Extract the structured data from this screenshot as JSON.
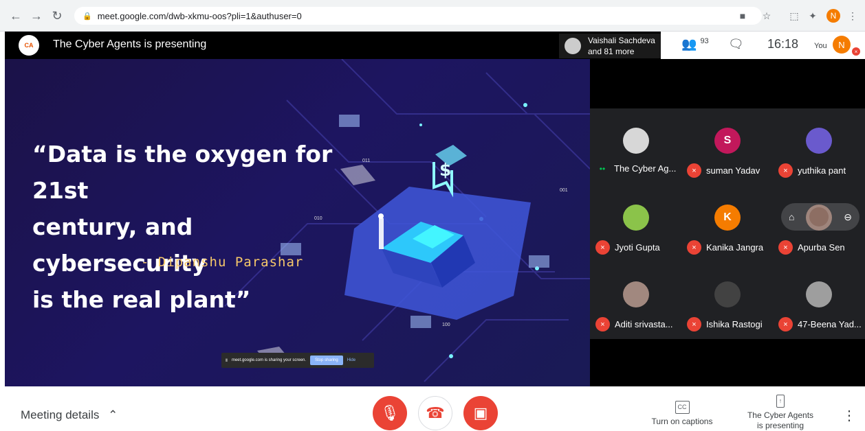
{
  "browser": {
    "url": "meet.google.com/dwb-xkmu-oos?pli=1&authuser=0",
    "profile_initial": "N"
  },
  "meeting": {
    "presenting_text": "The Cyber Agents is presenting",
    "attendees_chip": {
      "name": "Vaishali Sachdeva",
      "more": "and 81 more"
    },
    "participant_count": "93",
    "time": "16:18",
    "you_label": "You",
    "you_initial": "N"
  },
  "slide": {
    "quote_lines": [
      "“Data is the oxygen for 21st",
      "century, and cybersecurity",
      "is the real plant”"
    ],
    "author": "- Dipanshu Parashar",
    "share_notice": "meet.google.com is sharing your screen.",
    "stop_sharing": "Stop sharing",
    "hide": "Hide",
    "hex_labels": [
      "011",
      "010",
      "001",
      "100"
    ]
  },
  "participants": [
    {
      "name": "The Cyber Ag...",
      "initial": "",
      "color": "#d7d7d7",
      "muted": false,
      "speaking": true
    },
    {
      "name": "suman Yadav",
      "initial": "S",
      "color": "#c2185b",
      "muted": true,
      "speaking": false
    },
    {
      "name": "yuthika pant",
      "initial": "",
      "color": "#6a5acd",
      "muted": true,
      "speaking": false
    },
    {
      "name": "Jyoti Gupta",
      "initial": "",
      "color": "#8bc34a",
      "muted": true,
      "speaking": false
    },
    {
      "name": "Kanika Jangra",
      "initial": "K",
      "color": "#f57c00",
      "muted": true,
      "speaking": false
    },
    {
      "name": "Apurba Sen",
      "initial": "",
      "color": "#8d6e63",
      "muted": true,
      "speaking": false
    },
    {
      "name": "Aditi srivasta...",
      "initial": "",
      "color": "#a1887f",
      "muted": true,
      "speaking": false
    },
    {
      "name": "Ishika Rastogi",
      "initial": "",
      "color": "#424242",
      "muted": true,
      "speaking": false
    },
    {
      "name": "47-Beena Yad...",
      "initial": "",
      "color": "#9e9e9e",
      "muted": true,
      "speaking": false
    }
  ],
  "bottom": {
    "meeting_details": "Meeting details",
    "captions": "Turn on captions",
    "presenting_line1": "The Cyber Agents",
    "presenting_line2": "is presenting"
  },
  "colors": {
    "meet_red": "#ea4335",
    "meet_green": "#00c853",
    "slide_bg": "#1d1560",
    "author_text": "#f6c86a"
  },
  "icons": {
    "back": "arrow-left-icon",
    "forward": "arrow-right-icon",
    "reload": "reload-icon",
    "lock": "lock-icon",
    "people": "people-icon",
    "chat": "chat-icon",
    "mic_off": "mic-off-icon",
    "camera_off": "camera-off-icon",
    "hang_up": "phone-icon",
    "captions": "captions-icon",
    "present": "present-icon",
    "more": "more-vert-icon"
  }
}
